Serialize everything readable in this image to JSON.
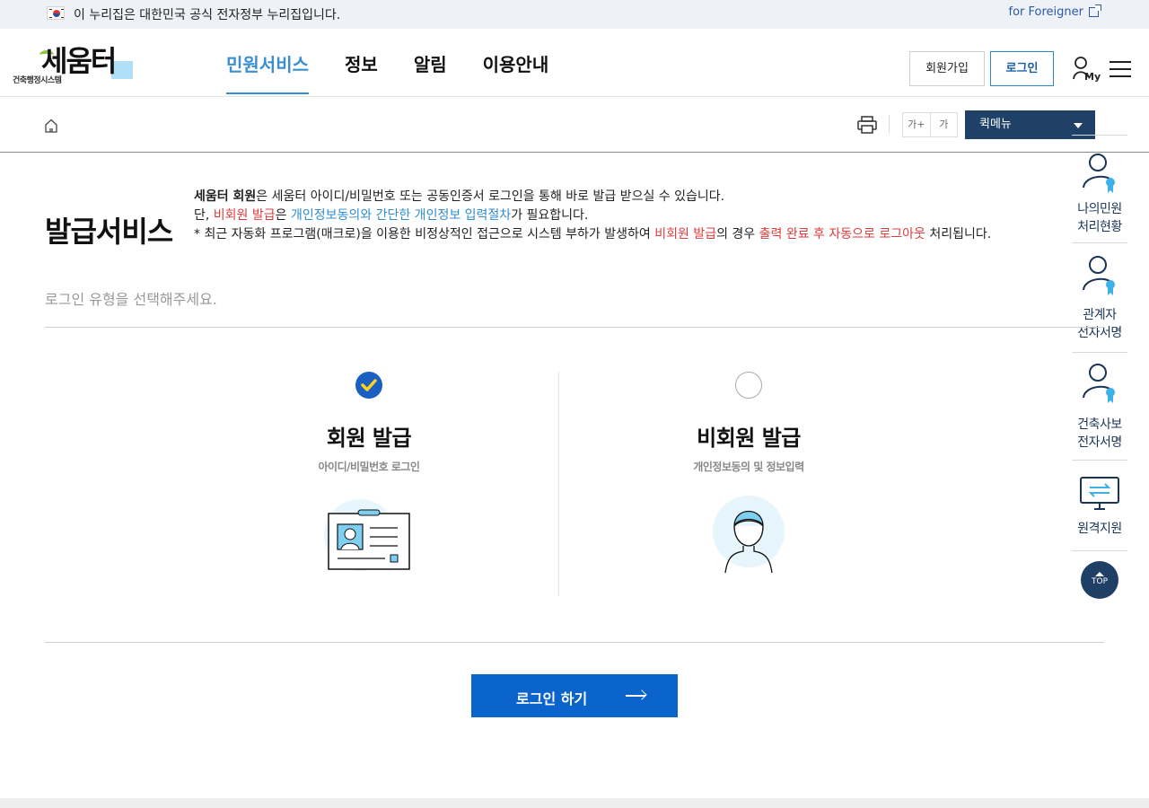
{
  "gov_banner": {
    "text": "이 누리집은 대한민국 공식 전자정부 누리집입니다.",
    "foreigner_link": "for Foreigner"
  },
  "header": {
    "logo_text": "세움터",
    "logo_sub": "건축행정시스템",
    "nav": [
      {
        "label": "민원서비스",
        "active": true
      },
      {
        "label": "정보",
        "active": false
      },
      {
        "label": "알림",
        "active": false
      },
      {
        "label": "이용안내",
        "active": false
      }
    ],
    "join_label": "회원가입",
    "login_label": "로그인",
    "my_label": "My"
  },
  "subbar": {
    "font_increase": "가+",
    "font_default": "가",
    "quick_menu": "퀵메뉴"
  },
  "quick_panel": [
    {
      "line1": "나의민원",
      "line2": "처리현황",
      "icon": "user-badge-icon"
    },
    {
      "line1": "관계자",
      "line2": "전자서명",
      "icon": "user-badge-icon"
    },
    {
      "line1": "건축사보",
      "line2": "전자서명",
      "icon": "user-badge-icon"
    },
    {
      "line1": "원격지원",
      "line2": "",
      "icon": "monitor-transfer-icon"
    }
  ],
  "top_button": "TOP",
  "main": {
    "title": "발급서비스",
    "notice": {
      "l1_bold": "세움터 회원",
      "l1_rest": "은 세움터 아이디/비밀번호 또는 공동인증서 로그인을 통해 바로 발급 받으실 수 있습니다.",
      "l2_pre": "단, ",
      "l2_red": "비회원 발급",
      "l2_mid": "은 ",
      "l2_blue": "개인정보동의와 간단한 개인정보 입력절차",
      "l2_end": "가 필요합니다.",
      "l3_pre": "* 최근 자동화 프로그램(매크로)을 이용한 비정상적인 접근으로 시스템 부하가 발생하여 ",
      "l3_red1": "비회원 발급",
      "l3_mid": "의 경우 ",
      "l3_red2": "출력 완료 후 자동으로 로그아웃",
      "l3_end": " 처리됩니다."
    },
    "select_hint": "로그인 유형을 선택해주세요.",
    "options": [
      {
        "title": "회원 발급",
        "sub": "아이디/비밀번호 로그인",
        "selected": true
      },
      {
        "title": "비회원 발급",
        "sub": "개인정보동의 및 정보입력",
        "selected": false
      }
    ],
    "submit_label": "로그인 하기"
  },
  "colors": {
    "primary": "#0b63cc",
    "nav_active": "#3a8fd0",
    "quick_bg": "#1f4067",
    "alert_red": "#e03a3a",
    "link_blue": "#2f8dd0"
  }
}
